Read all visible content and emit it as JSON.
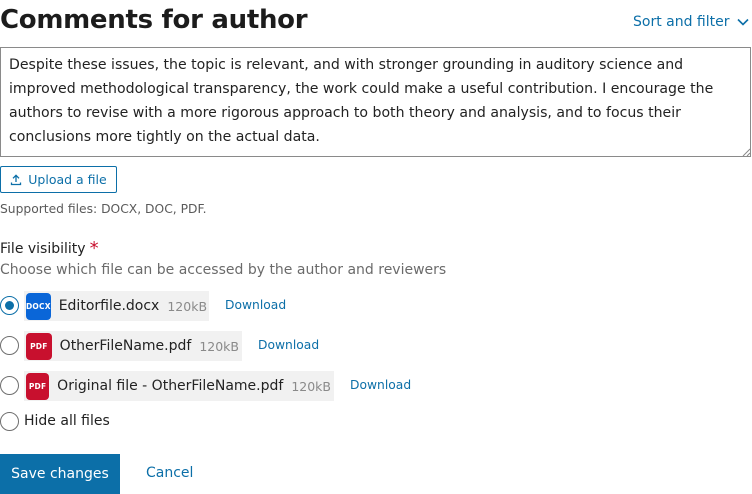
{
  "header": {
    "title": "Comments for author",
    "sort_filter_label": "Sort and filter",
    "sort_filter_icon": "chevron-down-icon"
  },
  "comment": {
    "text": "Despite these issues, the topic is relevant, and with stronger grounding in auditory science and improved methodological transparency, the work could make a useful contribution. I encourage the authors to revise with a more rigorous approach to both theory and analysis, and to focus their conclusions more tightly on the actual data."
  },
  "upload": {
    "button_label": "Upload a file",
    "icon": "upload-icon",
    "supported_files": "Supported files: DOCX, DOC, PDF."
  },
  "visibility": {
    "label": "File visibility",
    "required_marker": "*",
    "description": "Choose which file can be accessed by the author and reviewers",
    "files": [
      {
        "type_label": "DOCX",
        "name": "Editorfile.docx",
        "size": "120kB",
        "download_label": "Download",
        "selected": true,
        "icon_color": "#0a66d8"
      },
      {
        "type_label": "PDF",
        "name": "OtherFileName.pdf",
        "size": "120kB",
        "download_label": "Download",
        "selected": false,
        "icon_color": "#c8102e"
      },
      {
        "type_label": "PDF",
        "name": "Original file - OtherFileName.pdf",
        "size": "120kB",
        "download_label": "Download",
        "selected": false,
        "icon_color": "#c8102e"
      }
    ],
    "hide_all_label": "Hide all files"
  },
  "actions": {
    "save_label": "Save changes",
    "cancel_label": "Cancel"
  },
  "colors": {
    "accent": "#0c6fa8",
    "required": "#c8102e",
    "docx": "#0a66d8",
    "pdf": "#c8102e"
  }
}
